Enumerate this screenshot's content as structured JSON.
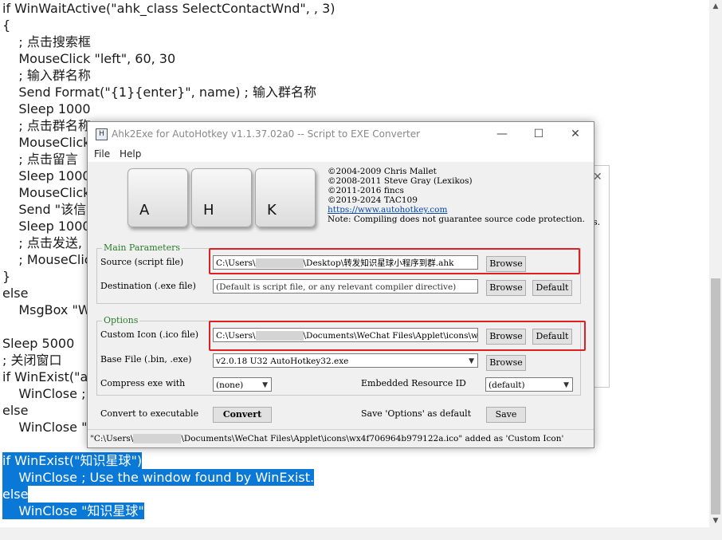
{
  "editor": {
    "lines": [
      "if WinWaitActive(\"ahk_class SelectContactWnd\", , 3)",
      "{",
      "    ; 点击搜索框",
      "    MouseClick \"left\", 60, 30",
      "    ; 输入群名称",
      "    Send Format(\"{1}{enter}\", name) ; 输入群名称",
      "    Sleep 1000",
      "    ; 点击群名称",
      "    MouseClick",
      "    ; 点击留言",
      "    Sleep 1000",
      "    MouseClick",
      "    Send \"该信息",
      "    Sleep 1000",
      "    ; 点击发送,",
      "    ; MouseClic",
      "}",
      "else",
      "    MsgBox \"W",
      "",
      "Sleep 5000",
      "; 关闭窗口",
      "if WinExist(\"ah",
      "    WinClose ;",
      "else",
      "    WinClose \"a",
      "",
      "if WinExist(\"知识星球\")",
      "    WinClose ; Use the window found by WinExist.",
      "else",
      "    WinClose \"知识星球\""
    ]
  },
  "dialog": {
    "title": "Ahk2Exe for AutoHotkey v1.1.37.02a0 -- Script to EXE Converter",
    "icon_label": "H",
    "controls": {
      "minimize": "—",
      "maximize": "☐",
      "close": "✕"
    },
    "menu": {
      "file": "File",
      "help": "Help"
    },
    "keys": [
      "A",
      "H",
      "K"
    ],
    "credits": [
      "©2004-2009 Chris Mallet",
      "©2008-2011 Steve Gray (Lexikos)",
      "©2011-2016 fincs",
      "©2019-2024 TAC109"
    ],
    "link": "https://www.autohotkey.com",
    "note": "Note: Compiling does not guarantee source code protection.",
    "main_params": {
      "legend": "Main Parameters",
      "source_label": "Source (script file)",
      "source_prefix": "C:\\Users\\",
      "source_suffix": "\\Desktop\\转发知识星球小程序到群.ahk",
      "source_browse": "Browse",
      "dest_label": "Destination (.exe file)",
      "dest_value": "(Default is script file, or any relevant compiler directive)",
      "dest_browse": "Browse",
      "dest_default": "Default"
    },
    "options": {
      "legend": "Options",
      "icon_label": "Custom Icon (.ico file)",
      "icon_prefix": "C:\\Users\\",
      "icon_suffix": "\\Documents\\WeChat Files\\Applet\\icons\\wx4f706964b979122a.ico",
      "icon_browse": "Browse",
      "icon_default": "Default",
      "base_label": "Base File (.bin, .exe)",
      "base_value": "v2.0.18 U32 AutoHotkey32.exe",
      "base_browse": "Browse",
      "compress_label": "Compress exe with",
      "compress_value": "(none)",
      "resource_label": "Embedded Resource ID",
      "resource_value": "(default)"
    },
    "convert_label": "Convert to executable",
    "convert_button": "Convert",
    "save_label": "Save 'Options' as default",
    "save_button": "Save",
    "status_prefix": "\"C:\\Users\\",
    "status_suffix": "\\Documents\\WeChat Files\\Applet\\icons\\wx4f706964b979122a.ico\" added as 'Custom Icon'",
    "behind_text": "s."
  },
  "colors": {
    "selection": "#0a78d7",
    "highlight_box": "#e02020",
    "legend": "#2b7a2b",
    "link": "#0645ad"
  }
}
